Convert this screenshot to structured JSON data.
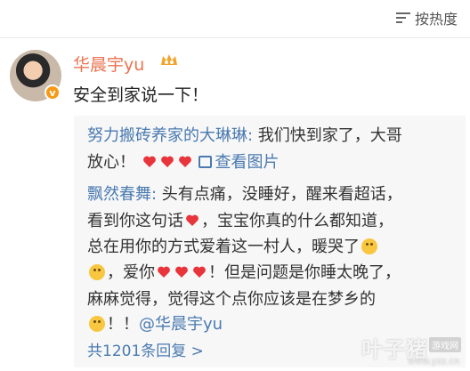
{
  "topbar": {
    "sort_label": "按热度",
    "sort_icon": "sort-lines-icon"
  },
  "post": {
    "username": "华晨宇yu",
    "text": "安全到家说一下！",
    "verified_mark": "v",
    "verified_color": "#f59a16",
    "username_color": "#eb7350"
  },
  "replies": {
    "r1": {
      "author": "努力搬砖养家的大琳琳:",
      "text": " 我们快到家了，大哥",
      "text2": "放心！",
      "view_image": "查看图片"
    },
    "r2": {
      "author": "飘然春舞:",
      "l1": " 头有点痛，没睡好，醒来看超话，",
      "l2a": "看到你这句话",
      "l2b": "，宝宝你真的什么都知道，",
      "l3": "总在用你的方式爱着这一村人，暖哭了",
      "l4a": "，爱你",
      "l4b": "！但是问题是你睡太晚了，",
      "l5": "麻麻觉得，觉得这个点你应该是在梦乡的",
      "l6a": "！！",
      "l6b": "@华晨宇yu"
    },
    "more": "共1201条回复 >"
  },
  "watermark": {
    "main": "叶子猪",
    "tag": "游戏网",
    "url": "www.yzz.cn"
  },
  "colors": {
    "link": "#4a7ab0",
    "heart": "#e8353b",
    "background": "#f7f7f7"
  }
}
